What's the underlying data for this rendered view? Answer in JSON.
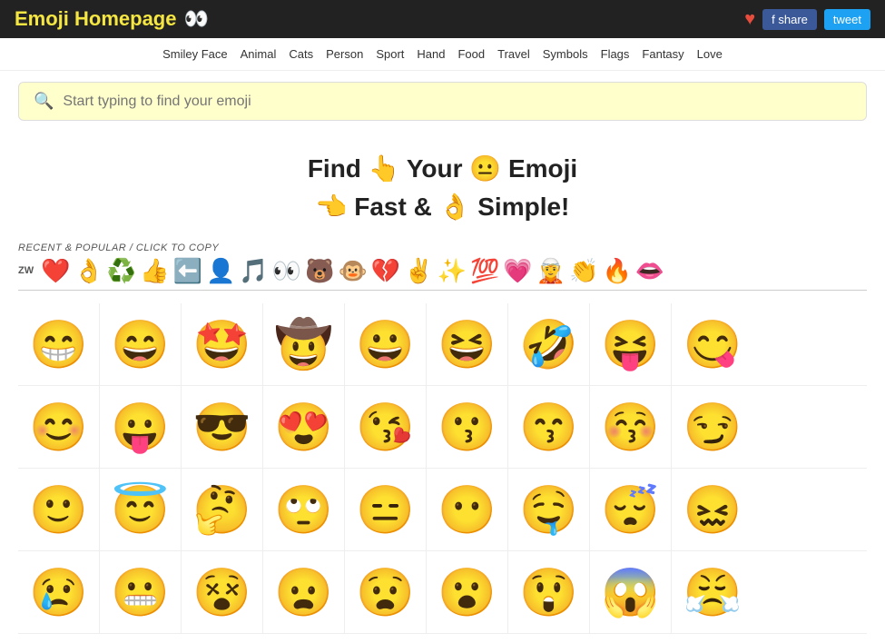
{
  "header": {
    "title": "Emoji Homepage",
    "eyes_emoji": "👀",
    "heart_icon": "♥",
    "share_label": "f share",
    "tweet_label": "tweet"
  },
  "nav": {
    "items": [
      {
        "label": "Smiley Face"
      },
      {
        "label": "Animal"
      },
      {
        "label": "Cats"
      },
      {
        "label": "Person"
      },
      {
        "label": "Sport"
      },
      {
        "label": "Hand"
      },
      {
        "label": "Food"
      },
      {
        "label": "Travel"
      },
      {
        "label": "Symbols"
      },
      {
        "label": "Flags"
      },
      {
        "label": "Fantasy"
      },
      {
        "label": "Love"
      }
    ]
  },
  "search": {
    "placeholder": "Start typing to find your emoji"
  },
  "hero": {
    "line1": "Find 👆 Your 😐 Emoji",
    "line2": "👈 Fast & 👌 Simple!"
  },
  "recent": {
    "label": "RECENT & POPULAR",
    "sublabel": "/ click to copy",
    "zw": "ZW",
    "emojis": [
      "❤️",
      "👌",
      "♻️",
      "👍",
      "⬅️",
      "👤",
      "🎵",
      "👀",
      "🐻",
      "🐵",
      "💔",
      "✌️",
      "✨",
      "💯",
      "💗",
      "🧝",
      "👏",
      "🔥",
      "👄"
    ]
  },
  "emoji_rows": [
    [
      "😁",
      "😄",
      "🤩",
      "🤠",
      "😀",
      "😆",
      "🤣",
      "😝",
      "😋"
    ],
    [
      "😊",
      "😛",
      "😎",
      "😍",
      "😘",
      "😗",
      "😙",
      "😚",
      "😏"
    ],
    [
      "🙂",
      "😇",
      "🤔",
      "🙄",
      "😑",
      "😶",
      "🤤",
      "😴",
      "😖"
    ],
    [
      "😢",
      "😬",
      "😵",
      "😦",
      "😧",
      "😮",
      "😲",
      "😱",
      "😤"
    ]
  ]
}
